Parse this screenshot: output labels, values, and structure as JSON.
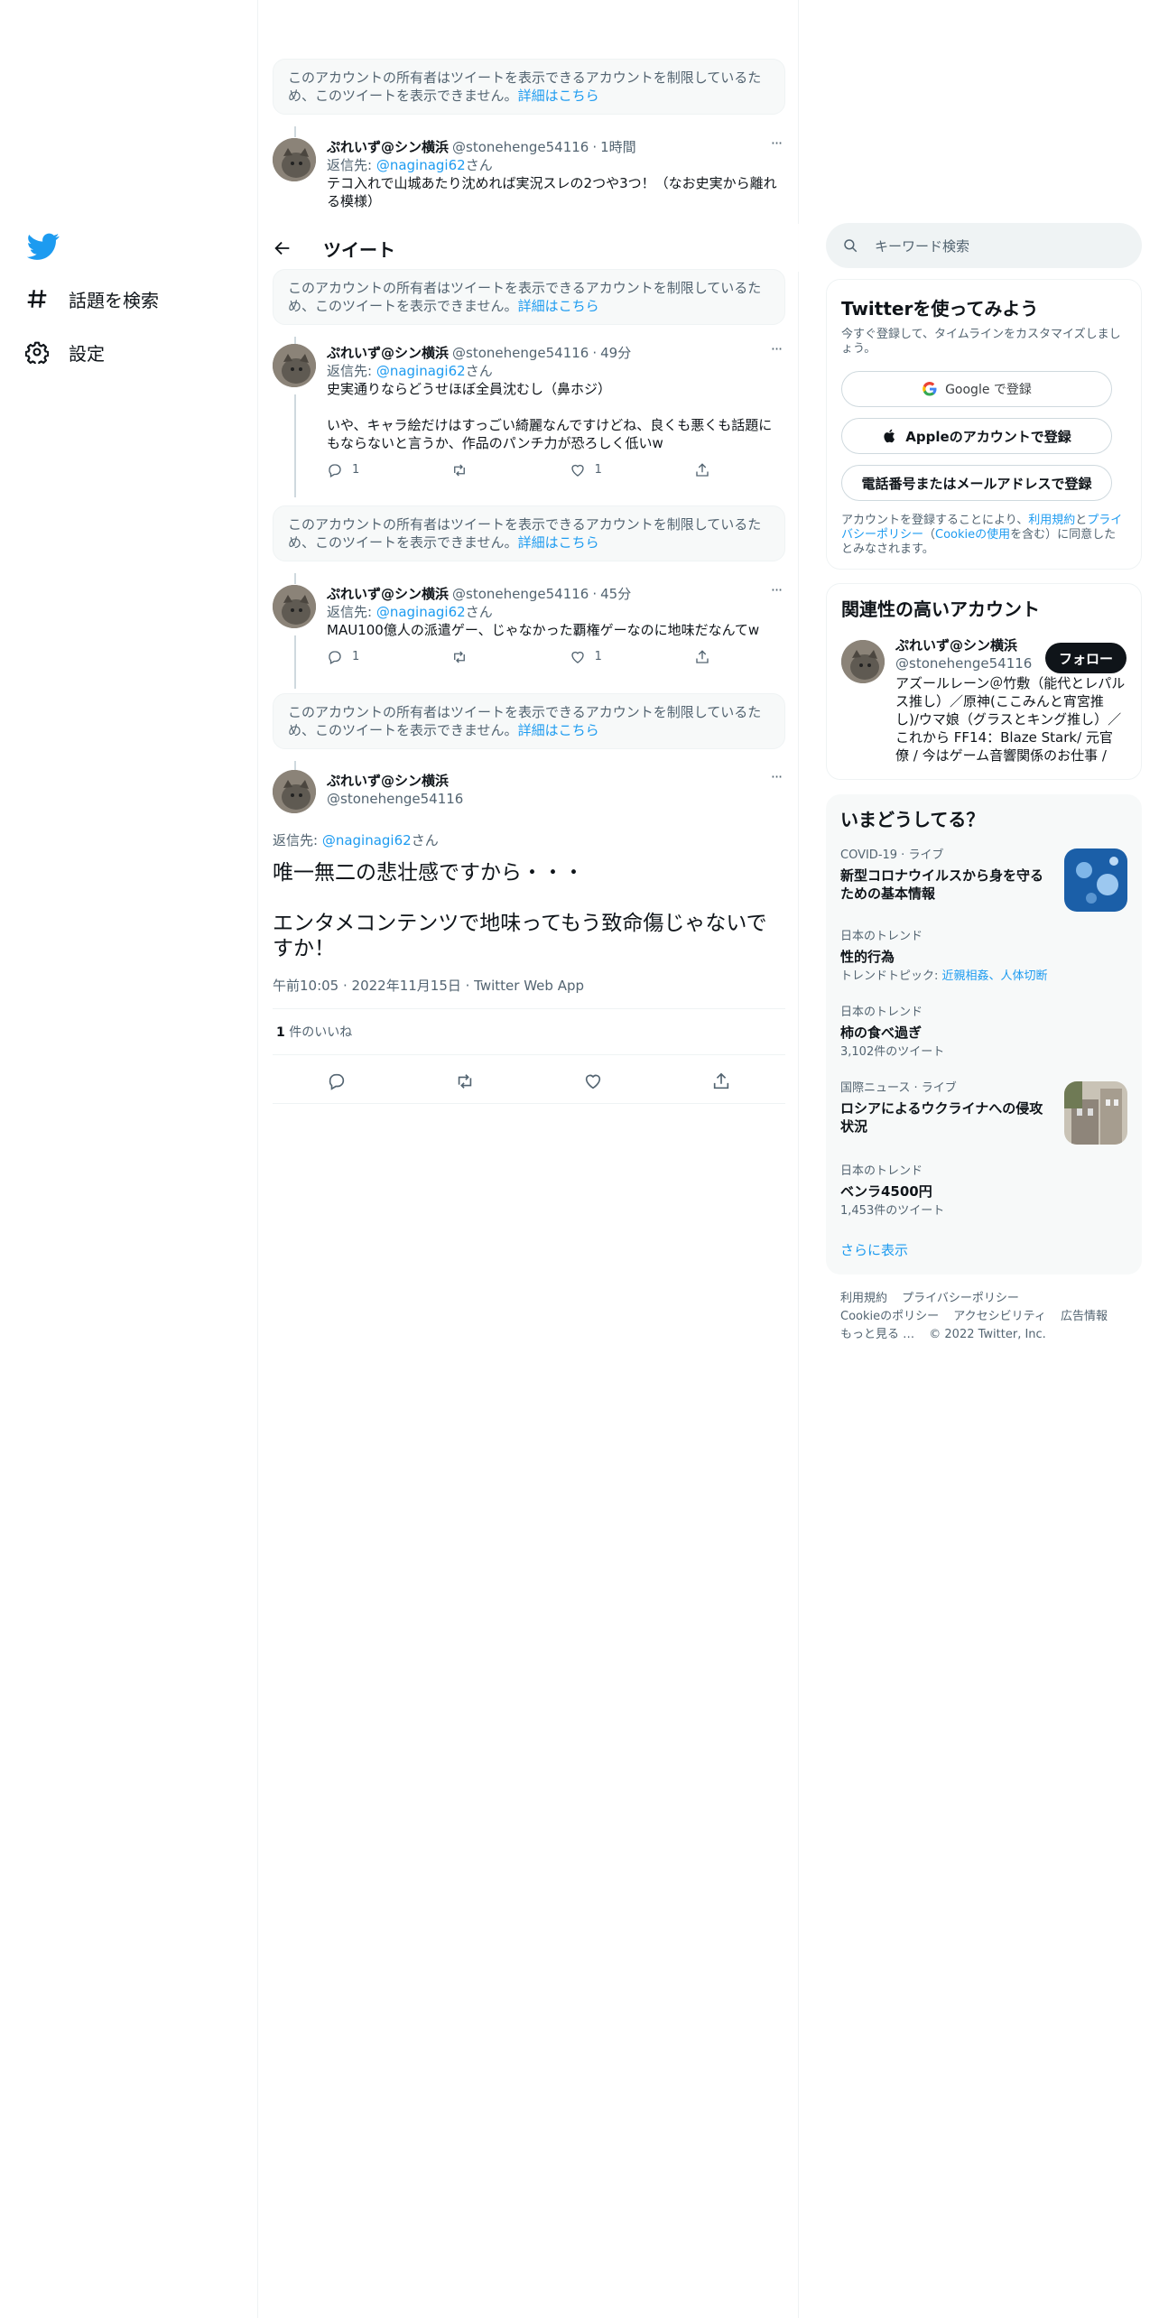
{
  "nav": {
    "explore_label": "話題を検索",
    "settings_label": "設定"
  },
  "header": {
    "title": "ツイート"
  },
  "restricted": {
    "text": "このアカウントの所有者はツイートを表示できるアカウントを制限しているため、このツイートを表示できません。",
    "link": "詳細はこちら"
  },
  "tweets": [
    {
      "name": "ぷれいず@シン横浜",
      "handle": "@stonehenge54116",
      "dot": "·",
      "time": "1時間",
      "reply_prefix": "返信先: ",
      "reply_handle": "@naginagi62",
      "reply_suffix": "さん",
      "text": "テコ入れで山城あたり沈めれば実況スレの2つや3つ！（なお史実から離れる模様）"
    },
    {
      "name": "ぷれいず@シン横浜",
      "handle": "@stonehenge54116",
      "dot": "·",
      "time": "49分",
      "reply_prefix": "返信先: ",
      "reply_handle": "@naginagi62",
      "reply_suffix": "さん",
      "text": "史実通りならどうせほぼ全員沈むし（鼻ホジ）\n\nいや、キャラ絵だけはすっごい綺麗なんですけどね、良くも悪くも話題にもならないと言うか、作品のパンチ力が恐ろしく低いw",
      "replies": "1",
      "retweets": "",
      "likes": "1"
    },
    {
      "name": "ぷれいず@シン横浜",
      "handle": "@stonehenge54116",
      "dot": "·",
      "time": "45分",
      "reply_prefix": "返信先: ",
      "reply_handle": "@naginagi62",
      "reply_suffix": "さん",
      "text": "MAU100億人の派遣ゲー、じゃなかった覇権ゲーなのに地味だなんてw",
      "replies": "1",
      "retweets": "",
      "likes": "1"
    }
  ],
  "focus": {
    "name": "ぷれいず@シン横浜",
    "handle": "@stonehenge54116",
    "reply_prefix": "返信先: ",
    "reply_handle": "@naginagi62",
    "reply_suffix": "さん",
    "text": "唯一無二の悲壮感ですから・・・\n\nエンタメコンテンツで地味ってもう致命傷じゃないですか！",
    "meta": "午前10:05 · 2022年11月15日 · Twitter Web App",
    "like_count": "1",
    "like_label": " 件のいいね"
  },
  "search": {
    "placeholder": "キーワード検索"
  },
  "signup": {
    "title": "Twitterを使ってみよう",
    "subtitle": "今すぐ登録して、タイムラインをカスタマイズしましょう。",
    "google_label": "Google で登録",
    "apple_label": "Appleのアカウントで登録",
    "phone_label": "電話番号またはメールアドレスで登録",
    "tos_prefix": "アカウントを登録することにより、",
    "tos_link": "利用規約",
    "tos_and": "と",
    "privacy_link": "プライバシーポリシー",
    "tos_open": "（",
    "cookie_link": "Cookieの使用",
    "tos_suffix": "を含む）に同意したとみなされます。"
  },
  "related": {
    "title": "関連性の高いアカウント",
    "name": "ぷれいず@シン横浜",
    "handle": "@stonehenge54116",
    "follow_label": "フォロー",
    "bio": "アズールレーン＠竹敷（能代とレパルス推し）／原神(ここみんと宵宮推し)/ウマ娘（グラスとキング推し）／これから FF14：Blaze Stark/ 元官僚 / 今はゲーム音響関係のお仕事 /"
  },
  "trends": {
    "title": "いまどうしてる？",
    "items": [
      {
        "meta": "COVID-19 · ライブ",
        "title": "新型コロナウイルスから身を守るための基本情報"
      },
      {
        "meta": "日本のトレンド",
        "title": "性的行為",
        "sub_prefix": "トレンドトピック: ",
        "sub_links": "近親相姦、人体切断"
      },
      {
        "meta": "日本のトレンド",
        "title": "柿の食べ過ぎ",
        "sub": "3,102件のツイート"
      },
      {
        "meta": "国際ニュース · ライブ",
        "title": "ロシアによるウクライナへの侵攻状況"
      },
      {
        "meta": "日本のトレンド",
        "title": "ベンラ4500円",
        "sub": "1,453件のツイート"
      }
    ],
    "show_more": "さらに表示"
  },
  "footer": {
    "terms": "利用規約",
    "privacy": "プライバシーポリシー",
    "cookie": "Cookieのポリシー",
    "accessibility": "アクセシビリティ",
    "ads": "広告情報",
    "more": "もっと見る …",
    "copyright": "© 2022 Twitter, Inc."
  },
  "colors": {
    "accent": "#1d9bf0",
    "text": "#0f1419",
    "muted": "#536471"
  }
}
